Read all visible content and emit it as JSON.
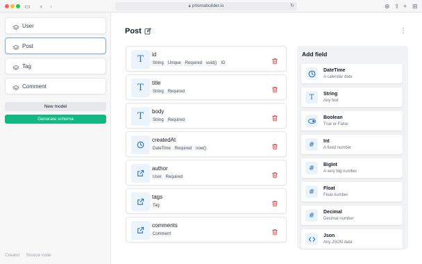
{
  "browser": {
    "url": "prismabuilder.io"
  },
  "sidebar": {
    "models": [
      {
        "label": "User"
      },
      {
        "label": "Post"
      },
      {
        "label": "Tag"
      },
      {
        "label": "Comment"
      }
    ],
    "new_model_label": "New model",
    "generate_label": "Generate schema",
    "footer_links": [
      "Creator",
      "Source code"
    ]
  },
  "main": {
    "title": "Post",
    "fields": [
      {
        "name": "id",
        "icon": "text-icon",
        "tags": [
          "String",
          "Unique",
          "Required",
          "uuid()",
          "ID"
        ]
      },
      {
        "name": "title",
        "icon": "text-icon",
        "tags": [
          "String",
          "Required"
        ]
      },
      {
        "name": "body",
        "icon": "text-icon",
        "tags": [
          "String",
          "Required"
        ]
      },
      {
        "name": "createdAt",
        "icon": "clock-icon",
        "tags": [
          "DateTime",
          "Required",
          "now()"
        ]
      },
      {
        "name": "author",
        "icon": "external-link-icon",
        "tags": [
          "User",
          "Required"
        ]
      },
      {
        "name": "tags",
        "icon": "external-link-icon",
        "tags": [
          "Tag"
        ]
      },
      {
        "name": "comments",
        "icon": "external-link-icon",
        "tags": [
          "Comment"
        ]
      }
    ]
  },
  "add_field": {
    "title": "Add field",
    "types": [
      {
        "name": "DateTime",
        "desc": "A calendar date",
        "icon": "clock-icon"
      },
      {
        "name": "String",
        "desc": "Any text",
        "icon": "text-icon"
      },
      {
        "name": "Boolean",
        "desc": "True or False",
        "icon": "toggle-icon"
      },
      {
        "name": "Int",
        "desc": "A fixed number",
        "icon": "hash-icon"
      },
      {
        "name": "BigInt",
        "desc": "A very big number",
        "icon": "hash-icon"
      },
      {
        "name": "Float",
        "desc": "Float number",
        "icon": "hash-icon"
      },
      {
        "name": "Decimal",
        "desc": "Decimal number",
        "icon": "hash-icon"
      },
      {
        "name": "Json",
        "desc": "Any JSON data",
        "icon": "code-icon"
      }
    ]
  },
  "colors": {
    "accent": "#2a6fb8",
    "generate": "#10b981",
    "delete": "#ef4444"
  }
}
